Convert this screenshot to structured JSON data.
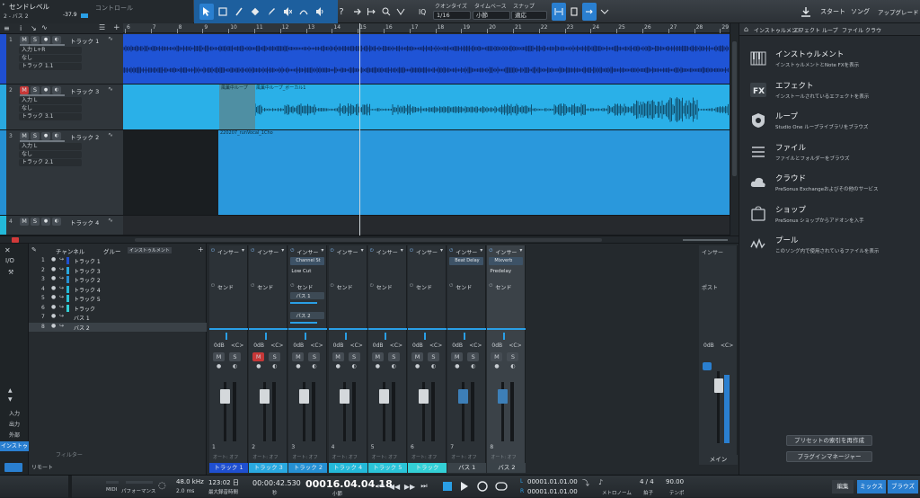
{
  "topbar": {
    "title": "センドレベル",
    "subtitle": "2 - バス 2",
    "value": "-37.9",
    "control_label": "コントロール",
    "quantize_label": "クオンタイズ",
    "quantize_value": "1/16",
    "timebase_label": "タイムベース",
    "timebase_value": "小節",
    "snap_label": "スナップ",
    "snap_value": "適応",
    "iq_label": "IQ",
    "start_label": "スタート",
    "song_label": "ソング",
    "upgrade_label": "アップグレード"
  },
  "browser_tabs": [
    "インストゥルメント",
    "エフェクト",
    "ループ",
    "ファイル",
    "クラウ"
  ],
  "browser_items": [
    {
      "title": "インストゥルメント",
      "desc": "インストゥルメントとNote FXを表示",
      "icon": "piano-icon"
    },
    {
      "title": "エフェクト",
      "desc": "インストールされているエフェクトを表示",
      "icon": "fx-icon"
    },
    {
      "title": "ループ",
      "desc": "Studio One ループライブラリをブラウズ",
      "icon": "loop-icon"
    },
    {
      "title": "ファイル",
      "desc": "ファイルとフォルダーをブラウズ",
      "icon": "file-icon"
    },
    {
      "title": "クラウド",
      "desc": "PreSonus Exchangeおよびその他のサービス",
      "icon": "cloud-icon"
    },
    {
      "title": "ショップ",
      "desc": "PreSonus ショップからアドオンを入手",
      "icon": "shop-icon"
    },
    {
      "title": "プール",
      "desc": "このソング内で使用されているファイルを表示",
      "icon": "pool-icon"
    }
  ],
  "browser_buttons": {
    "rebuild": "プリセットの索引を再作成",
    "plugin_manager": "プラグインマネージャー"
  },
  "tracks": [
    {
      "num": "1",
      "name": "トラック 1",
      "input": "入力 L+R",
      "sub1": "なし",
      "sub2": "トラック 1.1",
      "color": "#1f4fd1",
      "mute": false
    },
    {
      "num": "2",
      "name": "トラック 3",
      "input": "入力 L",
      "sub1": "なし",
      "sub2": "トラック 3.1",
      "color": "#29a9e0",
      "mute": true
    },
    {
      "num": "3",
      "name": "トラック 2",
      "input": "入力 L",
      "sub1": "なし",
      "sub2": "トラック 2.1",
      "color": "#2590d3",
      "mute": false
    },
    {
      "num": "4",
      "name": "トラック 4",
      "color": "#23b9d9",
      "mute": false
    }
  ],
  "ms": {
    "m": "M",
    "s": "S"
  },
  "ruler_numbers": [
    "6",
    "7",
    "8",
    "9",
    "10",
    "11",
    "12",
    "13",
    "14",
    "15",
    "16",
    "17",
    "18",
    "19",
    "20",
    "21",
    "22",
    "23",
    "24",
    "25",
    "26",
    "27",
    "28",
    "29"
  ],
  "clip_labels": {
    "c1": "風薫中ループ",
    "c2": "風薫中ループ_ボーカル1",
    "c3": "220207_runVocal_1Cho"
  },
  "channel_list": {
    "header_channel": "チャンネル",
    "header_group": "グルー",
    "header_inst": "インストゥルメント",
    "filter": "フィルター",
    "rows": [
      {
        "n": "1",
        "name": "トラック 1"
      },
      {
        "n": "2",
        "name": "トラック 3"
      },
      {
        "n": "3",
        "name": "トラック 2"
      },
      {
        "n": "4",
        "name": "トラック 4"
      },
      {
        "n": "5",
        "name": "トラック 5"
      },
      {
        "n": "6",
        "name": "トラック"
      },
      {
        "n": "7",
        "name": "バス 1"
      },
      {
        "n": "8",
        "name": "バス 2"
      }
    ]
  },
  "left_menu": [
    "入力",
    "出力",
    "外部",
    "インストゥ"
  ],
  "io_label": "I/O",
  "remote_label": "リモート",
  "strips": [
    {
      "label": "トラック 1",
      "color": "#1f4fd1",
      "num": "1",
      "insert": "インサー",
      "send": "センド",
      "pan": "<C>",
      "db": "0dB",
      "mute_active": false
    },
    {
      "label": "トラック 3",
      "color": "#29a9e0",
      "num": "2",
      "insert": "インサー",
      "send": "センド",
      "pan": "<C>",
      "db": "0dB",
      "mute_active": true
    },
    {
      "label": "トラック 2",
      "color": "#2590d3",
      "num": "3",
      "insert": "インサー",
      "send": "センド",
      "pan": "<C>",
      "db": "0dB",
      "mute_active": false,
      "ins1": "Channel St",
      "ins2": "Low Cut",
      "sends": [
        "バス 1",
        "バス 2"
      ]
    },
    {
      "label": "トラック 4",
      "color": "#23b9d9",
      "num": "4",
      "insert": "インサー",
      "send": "センド",
      "pan": "<C>",
      "db": "0dB",
      "mute_active": false
    },
    {
      "label": "トラック 5",
      "color": "#2ac4d8",
      "num": "5",
      "insert": "インサー",
      "send": "センド",
      "pan": "<C>",
      "db": "0dB",
      "mute_active": false
    },
    {
      "label": "トラック",
      "color": "#33d0d6",
      "num": "6",
      "insert": "インサー",
      "send": "センド",
      "pan": "<C>",
      "db": "0dB",
      "mute_active": false
    },
    {
      "label": "バス 1",
      "color": "#3a4248",
      "num": "7",
      "insert": "インサー",
      "send": "センド",
      "pan": "<C>",
      "db": "0dB",
      "mute_active": false,
      "ins1": "Beat Delay"
    },
    {
      "label": "バス 2",
      "color": "#3a4248",
      "num": "8",
      "insert": "インサー",
      "send": "センド",
      "pan": "<C>",
      "db": "0dB",
      "mute_active": false,
      "ins1": "Mixverb",
      "ins2": "Predelay"
    }
  ],
  "auto_label": "オート: オフ",
  "main_strip": {
    "label": "メイン",
    "insert": "インサー",
    "post": "ポスト",
    "db": "0dB",
    "pan": "<C>"
  },
  "transport": {
    "midi": "MIDI",
    "performance": "パフォーマンス",
    "sample_rate": "48.0 kHz",
    "latency": "2.0 ms",
    "record_time": "123:02 日",
    "record_label": "最大録音時間",
    "seconds": "00:00:42.530",
    "seconds_label": "秒",
    "bars": "00016.04.04.18",
    "bars_label": "小節",
    "loop_l": "00001.01.01.00",
    "loop_r": "00001.01.01.00",
    "l": "L",
    "r": "R",
    "metronome": "メトロノーム",
    "timesig": "4 / 4",
    "timesig_label": "拍子",
    "tempo": "90.00",
    "tempo_label": "テンポ",
    "tabs": [
      "編集",
      "ミックス",
      "ブラウズ"
    ]
  }
}
